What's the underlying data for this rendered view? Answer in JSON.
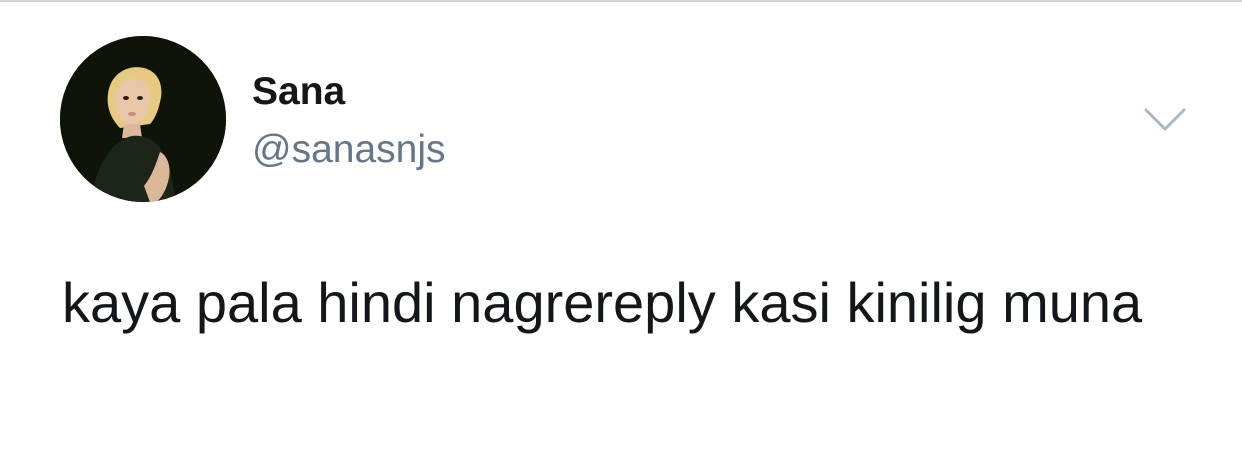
{
  "tweet": {
    "author": {
      "display_name": "Sana",
      "handle": "@sanasnjs",
      "avatar": "profile-photo"
    },
    "text": "kaya pala hindi nagrereply kasi kinilig muna",
    "menu_icon": "chevron-down-icon"
  },
  "colors": {
    "text_primary": "#14171a",
    "text_secondary": "#657786",
    "chevron": "#aab8c2",
    "divider": "#cfd3d6"
  }
}
